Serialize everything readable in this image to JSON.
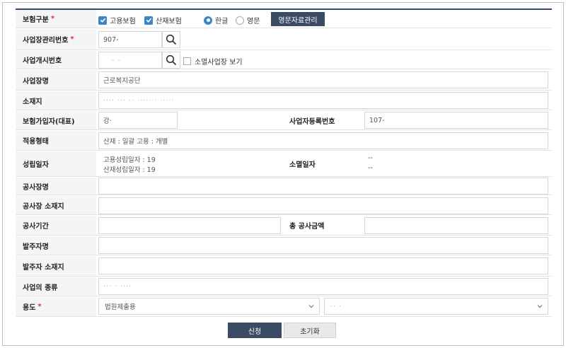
{
  "form": {
    "insurance_type": {
      "label": "보험구분",
      "options": [
        {
          "label": "고용보험",
          "checked": true
        },
        {
          "label": "산재보험",
          "checked": true
        }
      ],
      "language": [
        {
          "label": "한글",
          "selected": true
        },
        {
          "label": "영문",
          "selected": false
        }
      ],
      "english_mgmt_button": "영문자료관리"
    },
    "site_mgmt_no": {
      "label": "사업장관리번호",
      "value": "907-"
    },
    "open_biz_no": {
      "label": "사업개시번호",
      "value": "- -",
      "closed_checkbox_label": "소멸사업장 보기"
    },
    "site_name": {
      "label": "사업장명",
      "value": "근로복지공단"
    },
    "address": {
      "label": "소재지",
      "value": "···· ··· ·· ······· ·····"
    },
    "representative": {
      "label": "보험가입자(대표)",
      "value": "강·"
    },
    "biz_reg_no": {
      "label": "사업자등록번호",
      "value": "107-"
    },
    "apply_type": {
      "label": "적용형태",
      "value": "산재 : 일괄 고용 : 개별"
    },
    "established": {
      "label": "성립일자",
      "employment": "고용성립일자 : 19",
      "accident": "산재성립일자 : 19"
    },
    "extinct": {
      "label": "소멸일자",
      "line1": "--",
      "line2": "--"
    },
    "construction_name": {
      "label": "공사장명",
      "value": ""
    },
    "construction_address": {
      "label": "공사장 소재지",
      "value": ""
    },
    "construction_period": {
      "label": "공사기간",
      "value": ""
    },
    "total_amount": {
      "label": "총 공사금액",
      "value": ""
    },
    "client_name": {
      "label": "발주자명",
      "value": ""
    },
    "client_address": {
      "label": "발주자 소재지",
      "value": ""
    },
    "business_kind": {
      "label": "사업의 종류",
      "value": "··· · ····"
    },
    "purpose": {
      "label": "용도",
      "select1": "법원제출용",
      "select2": "·· ·"
    }
  },
  "actions": {
    "submit": "신청",
    "reset": "초기화"
  },
  "colors": {
    "accent": "#3d86c6",
    "navy": "#3a4b63",
    "required": "#d9342b"
  }
}
